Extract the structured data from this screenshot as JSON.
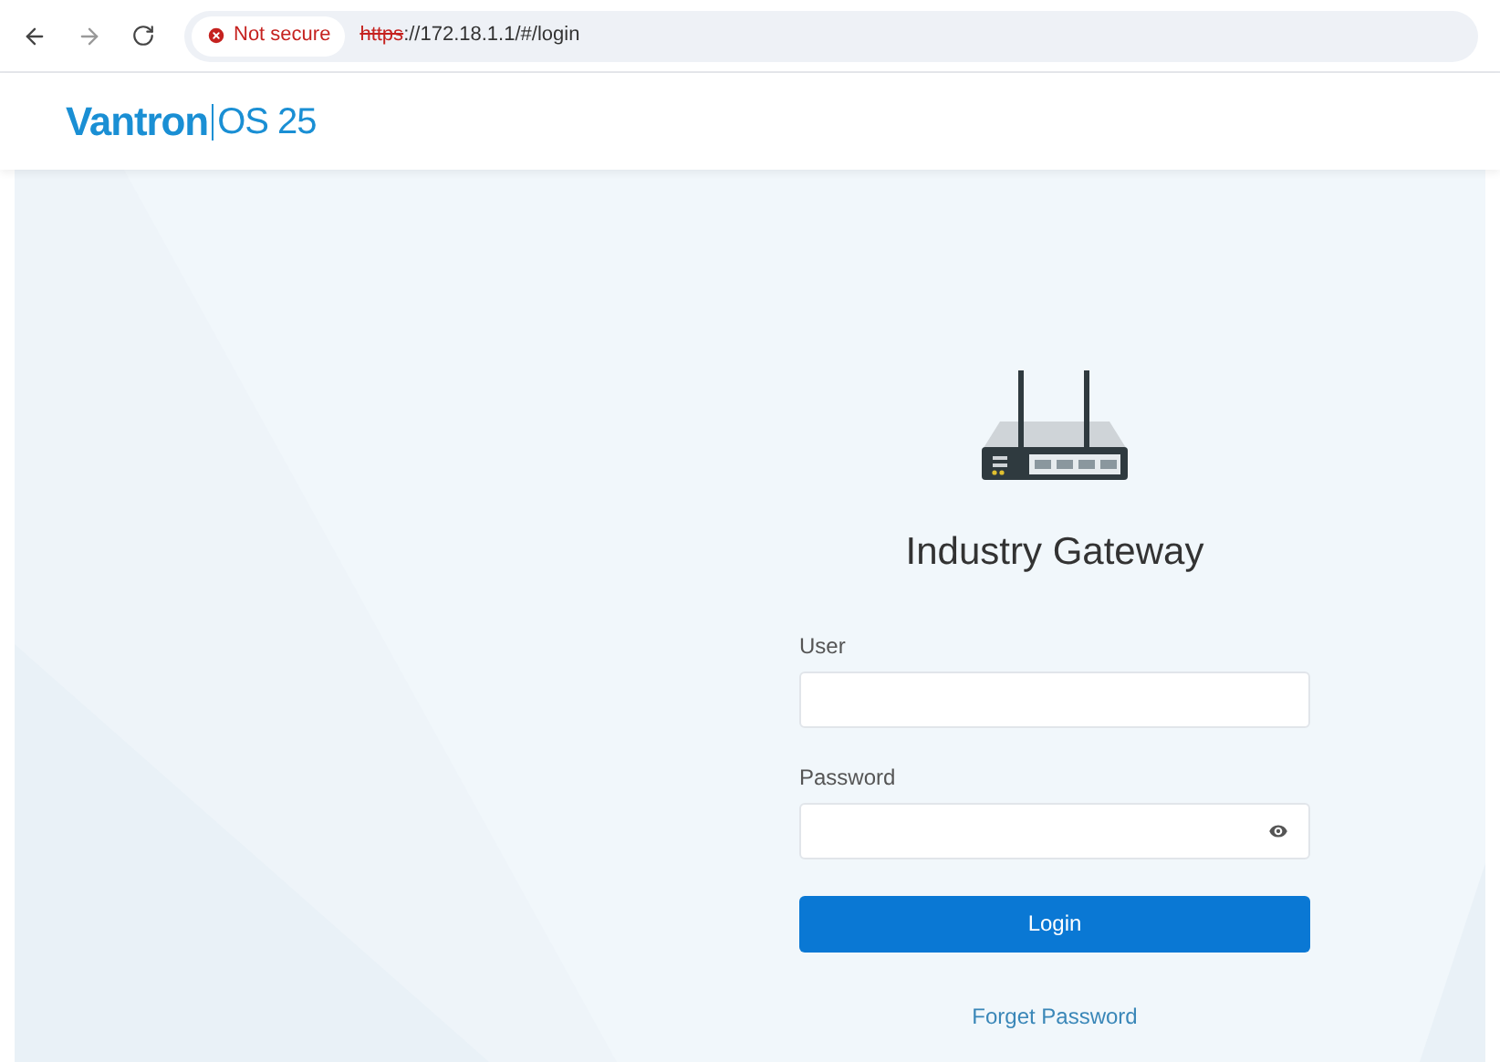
{
  "browser": {
    "security": "Not secure",
    "url_scheme": "https",
    "url_rest": "://172.18.1.1/#/login"
  },
  "header": {
    "brand": "Vantron",
    "product": "OS 25"
  },
  "login": {
    "title": "Industry Gateway",
    "fields": [
      {
        "label": "User",
        "kind": "text"
      },
      {
        "label": "Password",
        "kind": "password"
      }
    ],
    "button": "Login",
    "link": "Forget Password"
  }
}
